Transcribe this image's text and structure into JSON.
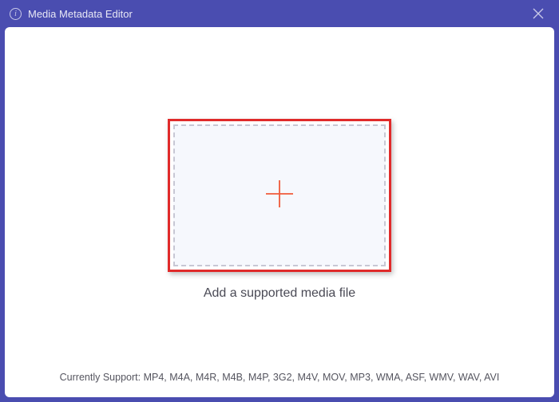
{
  "window": {
    "title": "Media Metadata Editor"
  },
  "main": {
    "dropzone_label": "Add a supported media file"
  },
  "footer": {
    "support_prefix": "Currently Support: ",
    "formats": [
      "MP4",
      "M4A",
      "M4R",
      "M4B",
      "M4P",
      "3G2",
      "M4V",
      "MOV",
      "MP3",
      "WMA",
      "ASF",
      "WMV",
      "WAV",
      "AVI"
    ]
  },
  "icons": {
    "info": "i"
  }
}
